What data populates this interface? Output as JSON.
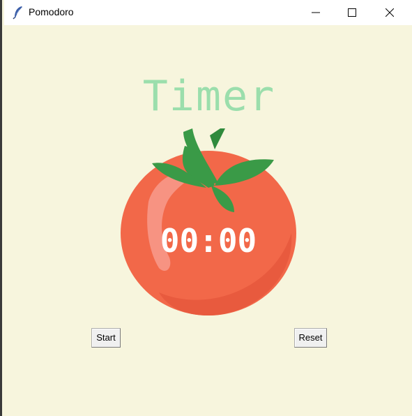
{
  "window": {
    "title": "Pomodoro",
    "app_icon": "feather-icon",
    "controls": {
      "minimize_icon": "minimize-icon",
      "maximize_icon": "maximize-icon",
      "close_icon": "close-icon"
    }
  },
  "main": {
    "heading": "Timer",
    "countdown": "00:00",
    "tomato_image": "tomato-icon",
    "start_label": "Start",
    "reset_label": "Reset"
  },
  "colors": {
    "background": "#f7f5dd",
    "heading": "#9bdeac",
    "tomato": "#f26849",
    "leaf": "#3a9a47",
    "countdown_text": "#ffffff"
  }
}
